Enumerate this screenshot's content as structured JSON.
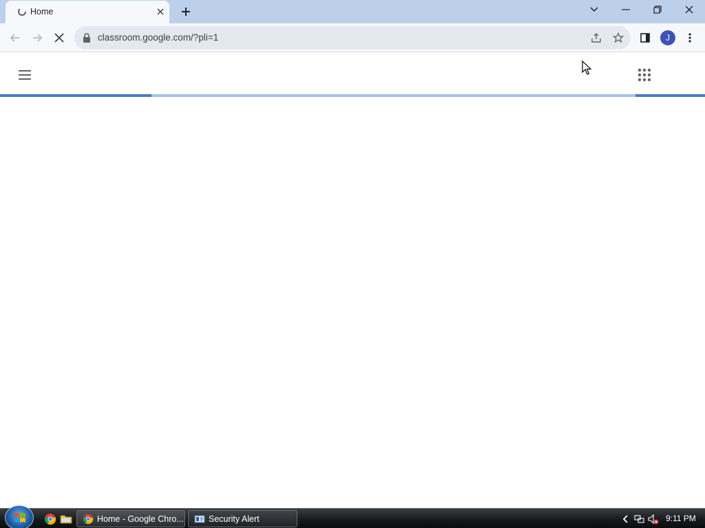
{
  "browser": {
    "tab": {
      "title": "Home",
      "favicon": "loading-favicon-icon",
      "close_icon": "close-icon"
    },
    "new_tab_icon": "plus-icon",
    "window_controls": [
      "tab-search-icon",
      "minimize-icon",
      "restore-icon",
      "close-icon"
    ],
    "toolbar": {
      "back_icon": "back-arrow-icon",
      "forward_icon": "forward-arrow-icon",
      "stop_icon": "stop-loading-icon",
      "url": "classroom.google.com/?pli=1",
      "share_icon": "share-icon",
      "bookmark_icon": "star-icon",
      "side_panel_icon": "side-panel-icon",
      "profile_initial": "J",
      "menu_icon": "kebab-menu-icon"
    }
  },
  "page": {
    "menu_icon": "hamburger-menu-icon",
    "apps_icon": "google-apps-grid-icon",
    "loading_bar": {
      "color": "#4a7ac4",
      "track_color": "#a7c1ea"
    }
  },
  "taskbar": {
    "start_icon": "windows-start-orb-icon",
    "quick_launch": [
      "chrome-icon",
      "folder-icon"
    ],
    "tasks": [
      {
        "label": "Home - Google Chro...",
        "icon": "chrome-icon",
        "active": true
      },
      {
        "label": "Security Alert",
        "icon": "security-alert-icon",
        "active": false
      }
    ],
    "tray": [
      "chevron-left-icon",
      "network-icon",
      "volume-muted-icon"
    ],
    "clock": "9:11 PM"
  }
}
